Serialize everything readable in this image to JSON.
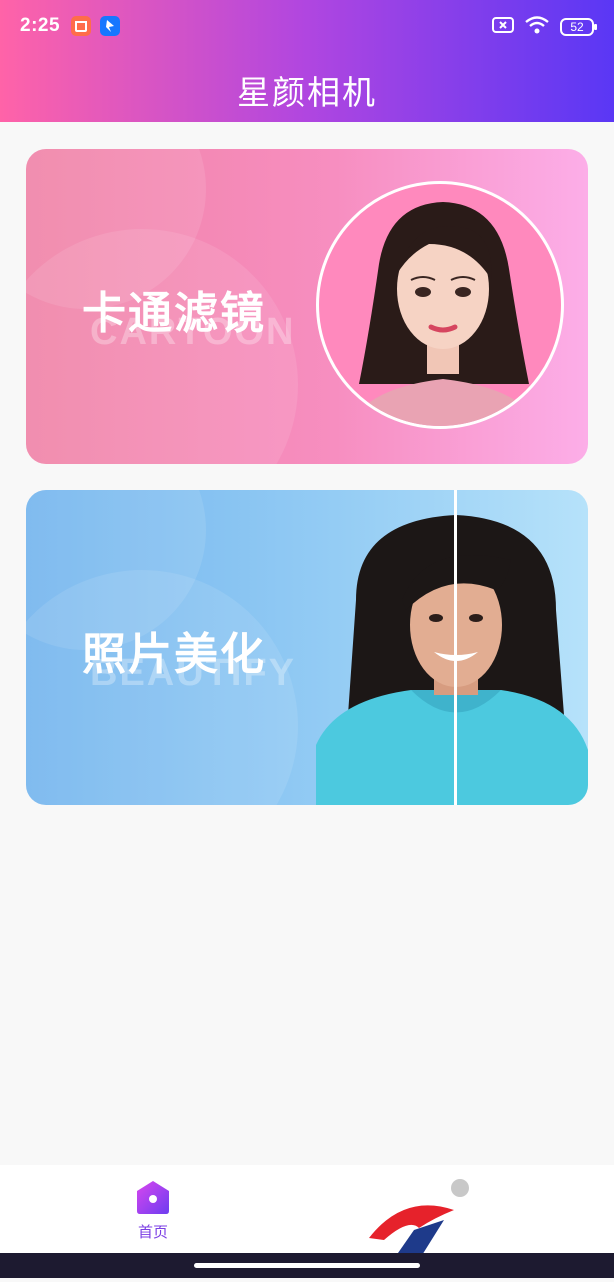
{
  "status_bar": {
    "time": "2:25",
    "battery": "52",
    "icons": [
      "notification-app-icon-orange",
      "notification-app-icon-blue",
      "close-box-icon",
      "wifi-icon",
      "battery-icon"
    ]
  },
  "header": {
    "title": "星颜相机"
  },
  "cards": [
    {
      "title": "卡通滤镜",
      "subtitle": "CARTOON"
    },
    {
      "title": "照片美化",
      "subtitle": "BEAUTIFY"
    }
  ],
  "tab_bar": {
    "items": [
      {
        "label": "首页",
        "icon": "home-icon"
      }
    ]
  },
  "colors": {
    "header_gradient": [
      "#ff63a8",
      "#b046e0",
      "#5a37f5"
    ],
    "cartoon_card": [
      "#f082a6",
      "#fcaee8"
    ],
    "beautify_card": [
      "#72b4ee",
      "#b6e2fa"
    ],
    "tab_active": "#7b3fe4"
  }
}
